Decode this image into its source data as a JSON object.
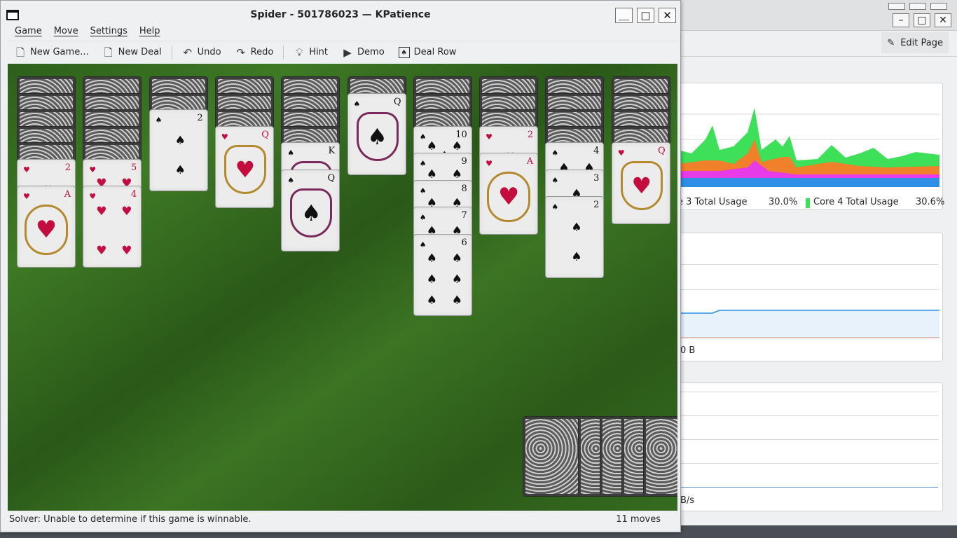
{
  "window": {
    "title": "Spider - 501786023 — KPatience",
    "buttons": {
      "minimize": "＿",
      "maximize": "□",
      "close": "✕"
    }
  },
  "menu": [
    "Game",
    "Move",
    "Settings",
    "Help"
  ],
  "toolbar": {
    "new_game": "New Game...",
    "new_deal": "New Deal",
    "undo": "Undo",
    "redo": "Redo",
    "hint": "Hint",
    "demo": "Demo",
    "deal_row": "Deal Row"
  },
  "status": {
    "solver": "Solver: Unable to determine if this game is winnable.",
    "moves": "11 moves"
  },
  "background_window": {
    "edit_page": "Edit Page",
    "legend": [
      "e 3 Total Usage",
      "30.0%",
      "Core 4 Total Usage",
      "30.6%"
    ],
    "memory_label": "0 B",
    "network_label": "B/s",
    "colors": {
      "green": "#3ee05a",
      "orange": "#f0802a",
      "magenta": "#e83be8",
      "blue": "#2f8fe6"
    }
  },
  "tableau": [
    {
      "hidden": 5,
      "cards": [
        {
          "rank": "2",
          "suit": "♥"
        },
        {
          "rank": "A",
          "suit": "♥"
        }
      ]
    },
    {
      "hidden": 5,
      "cards": [
        {
          "rank": "5",
          "suit": "♥"
        },
        {
          "rank": "4",
          "suit": "♥"
        }
      ]
    },
    {
      "hidden": 2,
      "cards": [
        {
          "rank": "2",
          "suit": "♠"
        }
      ]
    },
    {
      "hidden": 3,
      "cards": [
        {
          "rank": "Q",
          "suit": "♥"
        }
      ]
    },
    {
      "hidden": 4,
      "cards": [
        {
          "rank": "K",
          "suit": "♠"
        },
        {
          "rank": "Q",
          "suit": "♠"
        }
      ]
    },
    {
      "hidden": 1,
      "cards": [
        {
          "rank": "Q",
          "suit": "♠"
        }
      ]
    },
    {
      "hidden": 3,
      "cards": [
        {
          "rank": "10",
          "suit": "♠"
        },
        {
          "rank": "9",
          "suit": "♠"
        },
        {
          "rank": "8",
          "suit": "♠"
        },
        {
          "rank": "7",
          "suit": "♠"
        },
        {
          "rank": "6",
          "suit": "♠"
        }
      ]
    },
    {
      "hidden": 3,
      "cards": [
        {
          "rank": "2",
          "suit": "♥"
        },
        {
          "rank": "A",
          "suit": "♥"
        }
      ]
    },
    {
      "hidden": 4,
      "cards": [
        {
          "rank": "4",
          "suit": "♠"
        },
        {
          "rank": "3",
          "suit": "♠"
        },
        {
          "rank": "2",
          "suit": "♠"
        }
      ]
    },
    {
      "hidden": 4,
      "cards": [
        {
          "rank": "Q",
          "suit": "♥"
        }
      ]
    }
  ],
  "stock_piles": 5
}
